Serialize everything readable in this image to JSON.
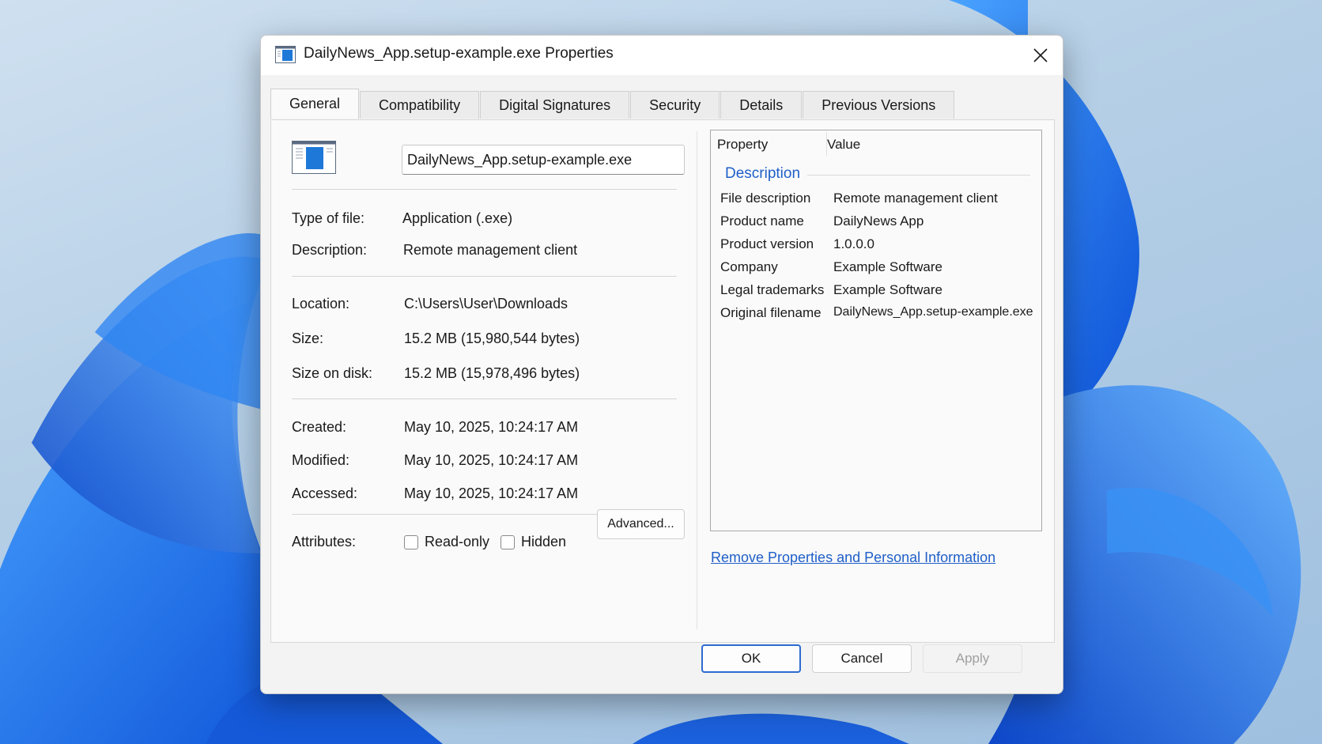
{
  "window": {
    "title": "DailyNews_App.setup-example.exe Properties",
    "app_icon": "exe-window-icon",
    "close_icon": "close-icon"
  },
  "tabs": [
    {
      "label": "General",
      "active": true
    },
    {
      "label": "Compatibility",
      "active": false
    },
    {
      "label": "Digital Signatures",
      "active": false
    },
    {
      "label": "Security",
      "active": false
    },
    {
      "label": "Details",
      "active": false
    },
    {
      "label": "Previous Versions",
      "active": false
    }
  ],
  "general": {
    "file_name": "DailyNews_App.setup-example.exe",
    "type_label": "Type of file:",
    "type_value": "Application (.exe)",
    "description_label": "Description:",
    "description_value": "Remote management client",
    "location_label": "Location:",
    "location_value": "C:\\Users\\User\\Downloads",
    "size_label": "Size:",
    "size_value": "15.2 MB (15,980,544 bytes)",
    "size_on_disk_label": "Size on disk:",
    "size_on_disk_value": "15.2 MB (15,978,496 bytes)",
    "created_label": "Created:",
    "created_value": "May 10, 2025, 10:24:17 AM",
    "modified_label": "Modified:",
    "modified_value": "May 10, 2025, 10:24:17 AM",
    "accessed_label": "Accessed:",
    "accessed_value": "May 10, 2025, 10:24:17 AM",
    "attributes_label": "Attributes:",
    "readonly_label": "Read-only",
    "hidden_label": "Hidden",
    "advanced_label": "Advanced..."
  },
  "details": {
    "property_header": "Property",
    "value_header": "Value",
    "group_title": "Description",
    "rows": [
      {
        "name": "File description",
        "value": "Remote management client"
      },
      {
        "name": "Product name",
        "value": "DailyNews App"
      },
      {
        "name": "Product version",
        "value": "1.0.0.0"
      },
      {
        "name": "Company",
        "value": "Example Software"
      },
      {
        "name": "Legal trademarks",
        "value": "Example Software"
      },
      {
        "name": "Original filename",
        "value": "DailyNews_App.setup-example.exe"
      }
    ],
    "remove_link": "Remove Properties and Personal Information"
  },
  "footer": {
    "ok_label": "OK",
    "cancel_label": "Cancel",
    "apply_label": "Apply"
  },
  "colors": {
    "accent": "#2d6bd1",
    "link": "#1f5fc8",
    "wallpaper_blue": "#1e6fe6"
  }
}
